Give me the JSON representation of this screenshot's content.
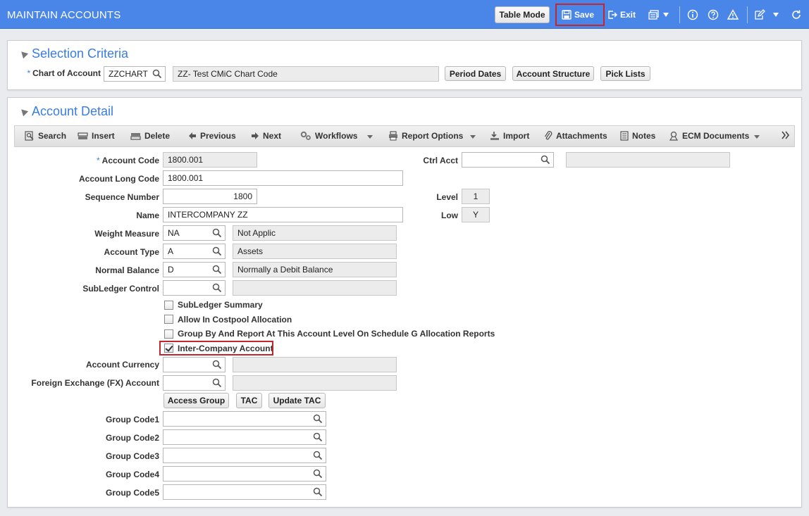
{
  "header": {
    "title": "MAINTAIN ACCOUNTS",
    "table_mode": "Table Mode",
    "save": "Save",
    "exit": "Exit"
  },
  "selection": {
    "title": "Selection Criteria",
    "chart_label": "Chart of Account",
    "chart_value": "ZZCHART",
    "chart_desc": "ZZ- Test CMiC Chart Code",
    "buttons": [
      "Period Dates",
      "Account Structure",
      "Pick Lists"
    ]
  },
  "detail": {
    "title": "Account Detail",
    "toolbar": {
      "search": "Search",
      "insert": "Insert",
      "delete": "Delete",
      "previous": "Previous",
      "next": "Next",
      "workflows": "Workflows",
      "report_options": "Report Options",
      "import": "Import",
      "attachments": "Attachments",
      "notes": "Notes",
      "ecm_documents": "ECM Documents"
    },
    "fields": {
      "account_code": {
        "label": "Account Code",
        "value": "1800.001"
      },
      "account_long_code": {
        "label": "Account Long Code",
        "value": "1800.001"
      },
      "sequence_number": {
        "label": "Sequence Number",
        "value": "1800"
      },
      "name": {
        "label": "Name",
        "value": "INTERCOMPANY ZZ"
      },
      "weight_measure": {
        "label": "Weight Measure",
        "value": "NA",
        "desc": "Not Applic"
      },
      "account_type": {
        "label": "Account Type",
        "value": "A",
        "desc": "Assets"
      },
      "normal_balance": {
        "label": "Normal Balance",
        "value": "D",
        "desc": "Normally a Debit Balance"
      },
      "subledger_control": {
        "label": "SubLedger Control",
        "value": "",
        "desc": ""
      },
      "ctrl_acct": {
        "label": "Ctrl Acct",
        "value": "",
        "desc": ""
      },
      "level": {
        "label": "Level",
        "value": "1"
      },
      "low": {
        "label": "Low",
        "value": "Y"
      },
      "account_currency": {
        "label": "Account Currency",
        "value": "",
        "desc": ""
      },
      "fx_account": {
        "label": "Foreign Exchange (FX) Account",
        "value": "",
        "desc": ""
      }
    },
    "checkboxes": [
      {
        "label": "SubLedger Summary",
        "checked": false
      },
      {
        "label": "Allow In Costpool Allocation",
        "checked": false
      },
      {
        "label": "Group By And Report At This Account Level On Schedule G Allocation Reports",
        "checked": false
      },
      {
        "label": "Inter-Company Account",
        "checked": true
      }
    ],
    "buttons": {
      "access_group": "Access Group",
      "tac": "TAC",
      "update_tac": "Update TAC"
    },
    "group_codes": [
      {
        "label": "Group Code1",
        "value": ""
      },
      {
        "label": "Group Code2",
        "value": ""
      },
      {
        "label": "Group Code3",
        "value": ""
      },
      {
        "label": "Group Code4",
        "value": ""
      },
      {
        "label": "Group Code5",
        "value": ""
      }
    ]
  },
  "colors": {
    "header_bg": "#4a86e8",
    "accent": "#3b7ddd",
    "highlight": "#c0282d"
  }
}
